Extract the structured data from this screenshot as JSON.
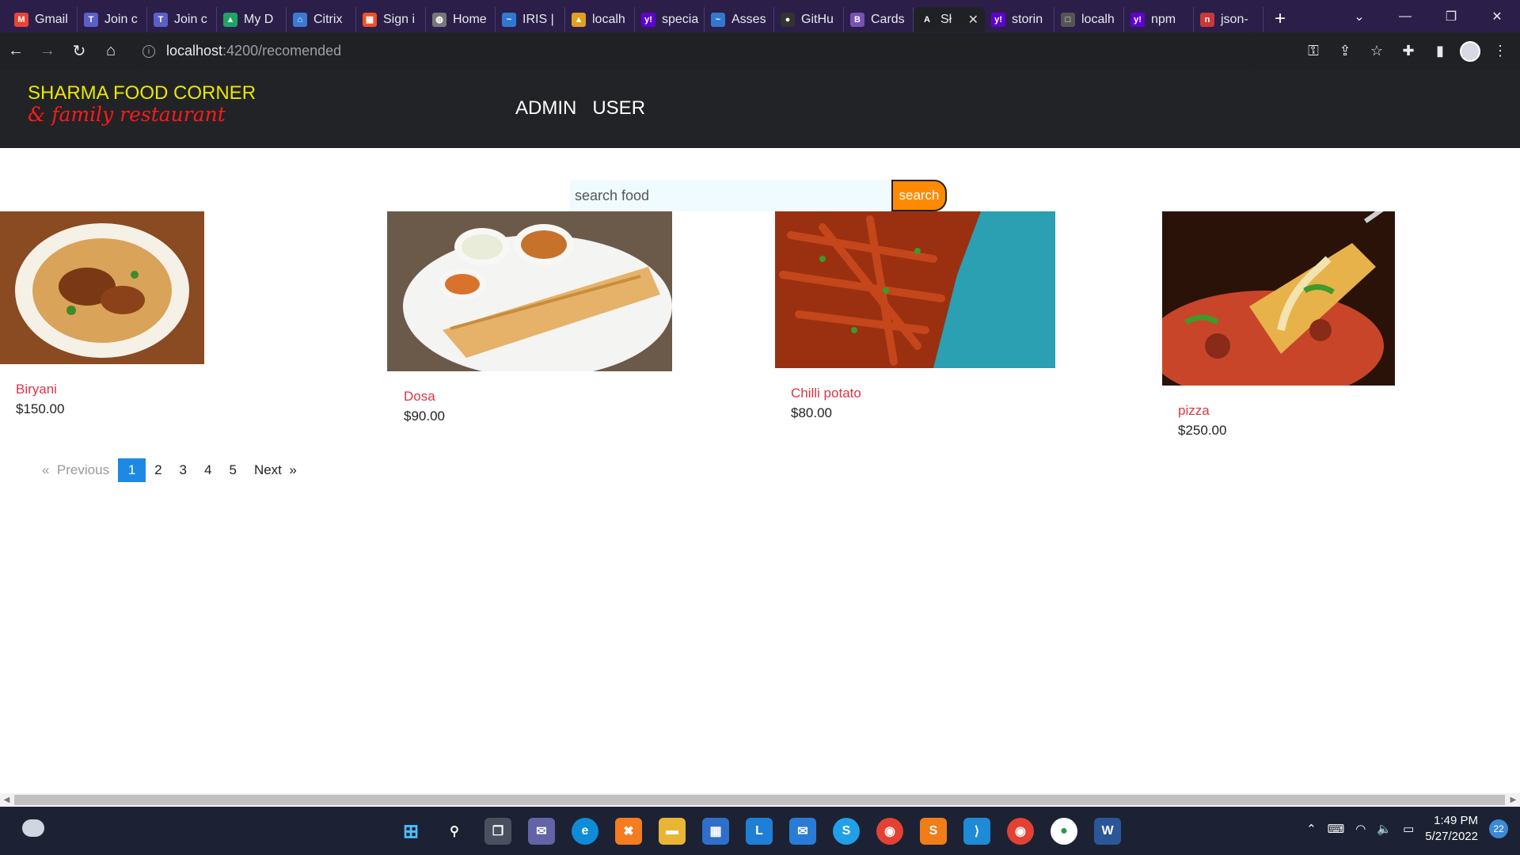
{
  "browser": {
    "tabs": [
      {
        "title": "Gmail",
        "icon": "gmail-icon",
        "color": "#ea4335",
        "glyph": "M"
      },
      {
        "title": "Join c",
        "icon": "teams-icon",
        "color": "#5b5fc7",
        "glyph": "T"
      },
      {
        "title": "Join c",
        "icon": "teams-icon",
        "color": "#5b5fc7",
        "glyph": "T"
      },
      {
        "title": "My D",
        "icon": "drive-icon",
        "color": "#1fa463",
        "glyph": "▲"
      },
      {
        "title": "Citrix",
        "icon": "citrix-icon",
        "color": "#3a7bd5",
        "glyph": "⌂"
      },
      {
        "title": "Sign i",
        "icon": "microsoft-icon",
        "color": "#f25022",
        "glyph": "▦"
      },
      {
        "title": "Home",
        "icon": "globe-icon",
        "color": "#777",
        "glyph": "◍"
      },
      {
        "title": "IRIS |",
        "icon": "iris-icon",
        "color": "#2f7ad0",
        "glyph": "~"
      },
      {
        "title": "localh",
        "icon": "localhost-icon",
        "color": "#e0a020",
        "glyph": "▲"
      },
      {
        "title": "specia",
        "icon": "yahoo-icon",
        "color": "#6001d2",
        "glyph": "y!"
      },
      {
        "title": "Asses",
        "icon": "assess-icon",
        "color": "#2f7ad0",
        "glyph": "~"
      },
      {
        "title": "GitHu",
        "icon": "github-icon",
        "color": "#333",
        "glyph": "●"
      },
      {
        "title": "Cards",
        "icon": "bootstrap-icon",
        "color": "#7952b3",
        "glyph": "B"
      },
      {
        "title": "Sł",
        "icon": "angular-icon",
        "color": "#202124",
        "glyph": "A",
        "active": true
      },
      {
        "title": "storin",
        "icon": "yahoo-icon",
        "color": "#6001d2",
        "glyph": "y!"
      },
      {
        "title": "localh",
        "icon": "localhost-icon",
        "color": "#555",
        "glyph": "□"
      },
      {
        "title": "npm",
        "icon": "yahoo-icon",
        "color": "#6001d2",
        "glyph": "y!"
      },
      {
        "title": "json-",
        "icon": "npm-icon",
        "color": "#cb3837",
        "glyph": "n"
      }
    ],
    "url_host": "localhost",
    "url_path": ":4200/recomended"
  },
  "header": {
    "brand_line1": "SHARMA FOOD CORNER",
    "brand_line2": "& family restaurant",
    "nav": {
      "admin": "ADMIN",
      "user": "USER"
    }
  },
  "search": {
    "placeholder": "search food",
    "button_label": "search"
  },
  "products": [
    {
      "name": "Biryani",
      "price": "$150.00",
      "image": "biryani-image"
    },
    {
      "name": "Dosa",
      "price": "$90.00",
      "image": "dosa-image"
    },
    {
      "name": "Chilli potato",
      "price": "$80.00",
      "image": "chilli-potato-image"
    },
    {
      "name": "pizza",
      "price": "$250.00",
      "image": "pizza-image"
    }
  ],
  "pagination": {
    "previous": "Previous",
    "next": "Next",
    "prev_icon": "«",
    "next_icon": "»",
    "pages": [
      "1",
      "2",
      "3",
      "4",
      "5"
    ],
    "current": "1"
  },
  "taskbar": {
    "time": "1:49 PM",
    "date": "5/27/2022",
    "notifications": "22"
  }
}
